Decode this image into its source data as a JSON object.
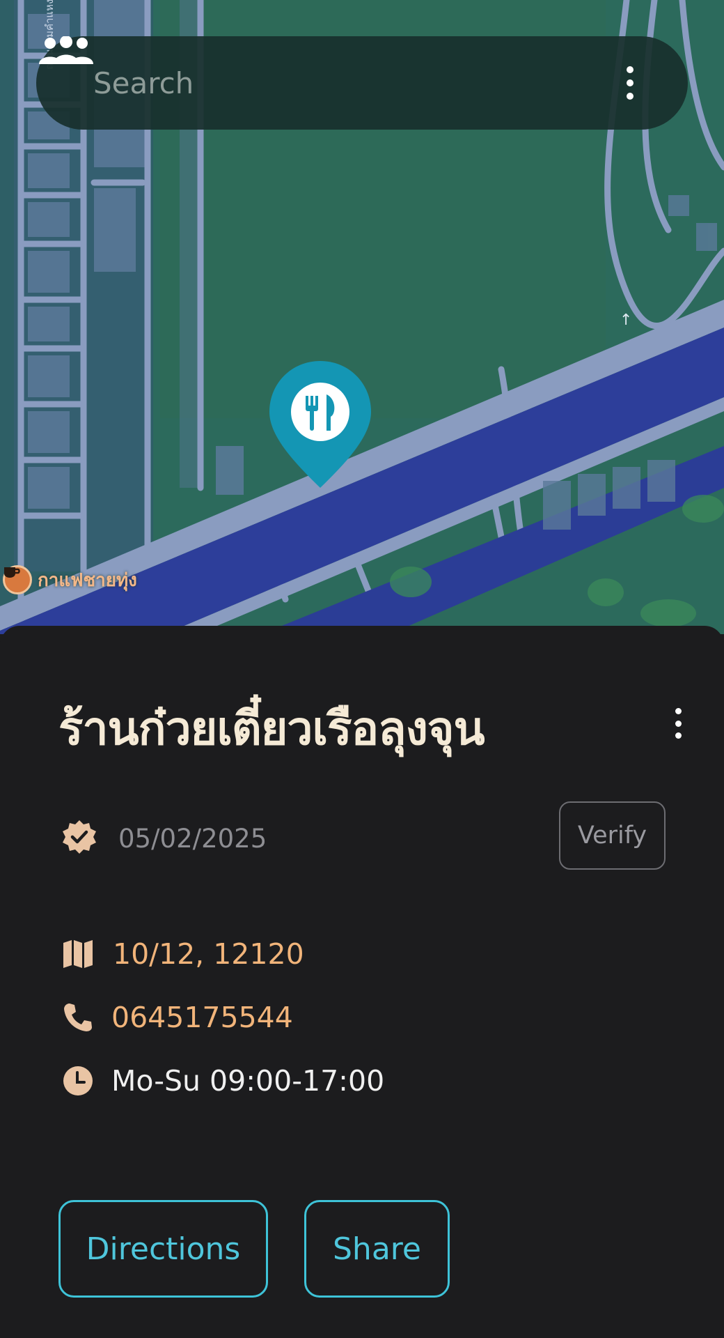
{
  "search": {
    "placeholder": "Search",
    "group_icon": "group-icon",
    "menu_icon": "more-vertical-icon"
  },
  "map": {
    "pin_icon": "fork-knife-icon",
    "pin_color": "#1496b4",
    "poi": {
      "label": "กาแฟชายทุ่ง",
      "icon": "coffee-icon"
    },
    "road_label": "ถนนรามคำแหง"
  },
  "place": {
    "name": "ร้านก๋วยเตี๋ยวเรือลุงจุน",
    "menu_icon": "more-vertical-icon",
    "verified_icon": "verified-badge-icon",
    "verified_date": "05/02/2025",
    "verify_label": "Verify",
    "address": "10/12, 12120",
    "address_icon": "map-icon",
    "phone": "0645175544",
    "phone_icon": "phone-icon",
    "hours": "Mo-Su 09:00-17:00",
    "hours_icon": "clock-icon"
  },
  "actions": {
    "directions_label": "Directions",
    "share_label": "Share"
  },
  "colors": {
    "accent_orange": "#f1b47a",
    "accent_cyan": "#4fc6dc",
    "sheet_bg": "#1c1c1e",
    "title": "#f5ead6"
  }
}
